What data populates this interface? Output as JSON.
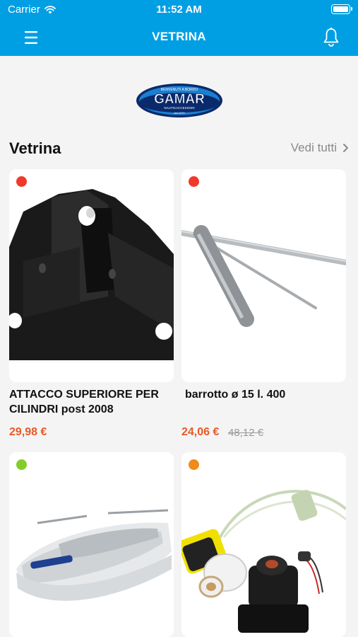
{
  "status": {
    "carrier": "Carrier",
    "time": "11:52 AM"
  },
  "header": {
    "title": "VETRINA"
  },
  "brand": {
    "top_text": "BENVENUTI A BORDO",
    "name": "GAMAR",
    "bottom_text": "NAUTICACCESSORI",
    "sub_text": "dal 1979"
  },
  "section": {
    "title": "Vetrina",
    "see_all": "Vedi tutti"
  },
  "products": [
    {
      "name": "ATTACCO SUPERIORE PER CILINDRI post 2008",
      "price": "29,98 €",
      "old_price": "",
      "status_color": "#f0392b"
    },
    {
      "name": "barrotto ø 15 l. 400",
      "price": "24,06 €",
      "old_price": "48,12 €",
      "status_color": "#f0392b"
    },
    {
      "name": "",
      "price": "",
      "old_price": "",
      "status_color": "#84cc2a"
    },
    {
      "name": "",
      "price": "",
      "old_price": "",
      "status_color": "#f08a1a"
    }
  ],
  "colors": {
    "primary": "#009fe3",
    "price": "#e75a26",
    "background": "#f4f4f4"
  },
  "icons": [
    "wifi-icon",
    "battery-icon",
    "menu-icon",
    "bell-icon",
    "chevron-right-icon"
  ]
}
